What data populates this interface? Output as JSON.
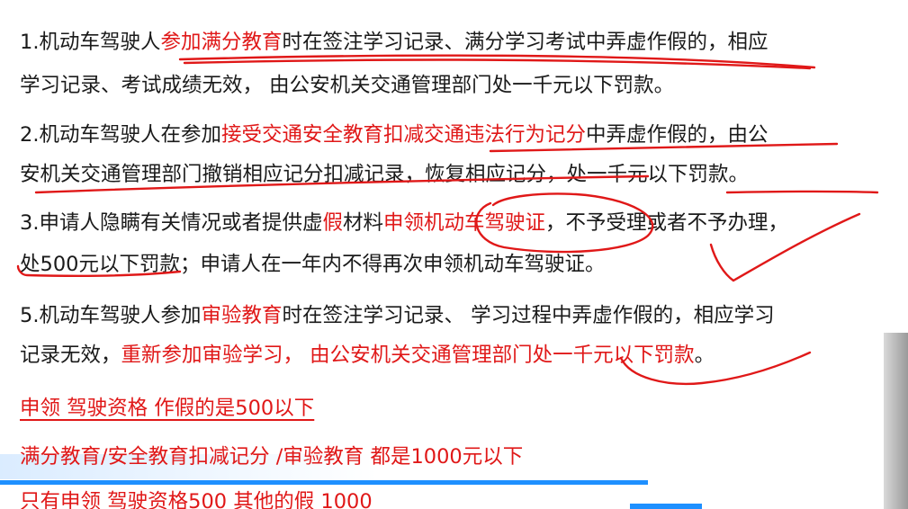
{
  "paragraphs": [
    {
      "line1": [
        "1.机动车驾驶人",
        "参加满分教育",
        "时在签注学习记录、满分学习考试中弄虚作假的，相应"
      ],
      "line2": [
        "学习记录、考试成绩无效， 由公安机关交通管理部门",
        "处一千元以下罚款",
        "。"
      ]
    },
    {
      "line1": [
        "2.机动车驾驶人在参加",
        "接受交通安全教育扣减交通违法行为记分",
        "中弄虚作假的，由公"
      ],
      "line2": [
        "安机关交通管理部门撤销相应记分扣减记录，恢复相应记分，处一千元以下罚款。"
      ]
    },
    {
      "line1": [
        "3.申请人隐瞒有关情况或者提供虚",
        "假",
        "材料",
        "申领机动车驾驶证",
        "，不予受理或者不予办理，"
      ],
      "line2": [
        "处500元以下罚款；申请人在一年内不得再次申领机动车驾驶证。"
      ]
    },
    {
      "line1": [
        "5.机动车驾驶人参加",
        "审验教育",
        "时在签注学习记录、 学习过程中弄虚作假的，相应学习"
      ],
      "line2": [
        "记录无效，",
        "重新参加审验学习， 由公安机关交通管理部门处一千元以下罚款",
        "。"
      ]
    }
  ],
  "notes": [
    "申领 驾驶资格 作假的是500以下",
    "满分教育/安全教育扣减记分 /审验教育 都是1000元以下",
    "只有申领 驾驶资格500 其他的假 1000"
  ],
  "colors": {
    "highlight": "#e01818",
    "text": "#1a1a1a",
    "bar": "#1e90ff"
  }
}
